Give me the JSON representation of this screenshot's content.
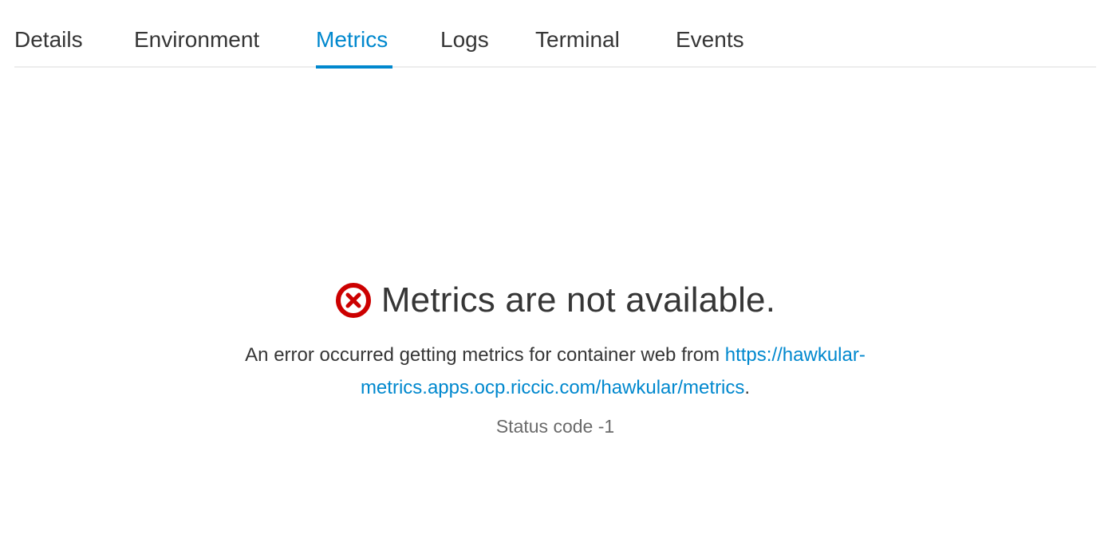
{
  "tabs": [
    {
      "label": "Details"
    },
    {
      "label": "Environment"
    },
    {
      "label": "Metrics"
    },
    {
      "label": "Logs"
    },
    {
      "label": "Terminal"
    },
    {
      "label": "Events"
    }
  ],
  "empty_state": {
    "icon": "error-circle-o-icon",
    "icon_color": "#cc0000",
    "title": "Metrics are not available.",
    "message_prefix": "An error occurred getting metrics for container web from ",
    "message_link": "https://hawkular-metrics.apps.ocp.riccic.com/hawkular/metrics",
    "message_suffix": ".",
    "status": "Status code -1"
  },
  "colors": {
    "accent": "#0088ce",
    "text": "#363636",
    "muted": "#6a6a6a"
  }
}
